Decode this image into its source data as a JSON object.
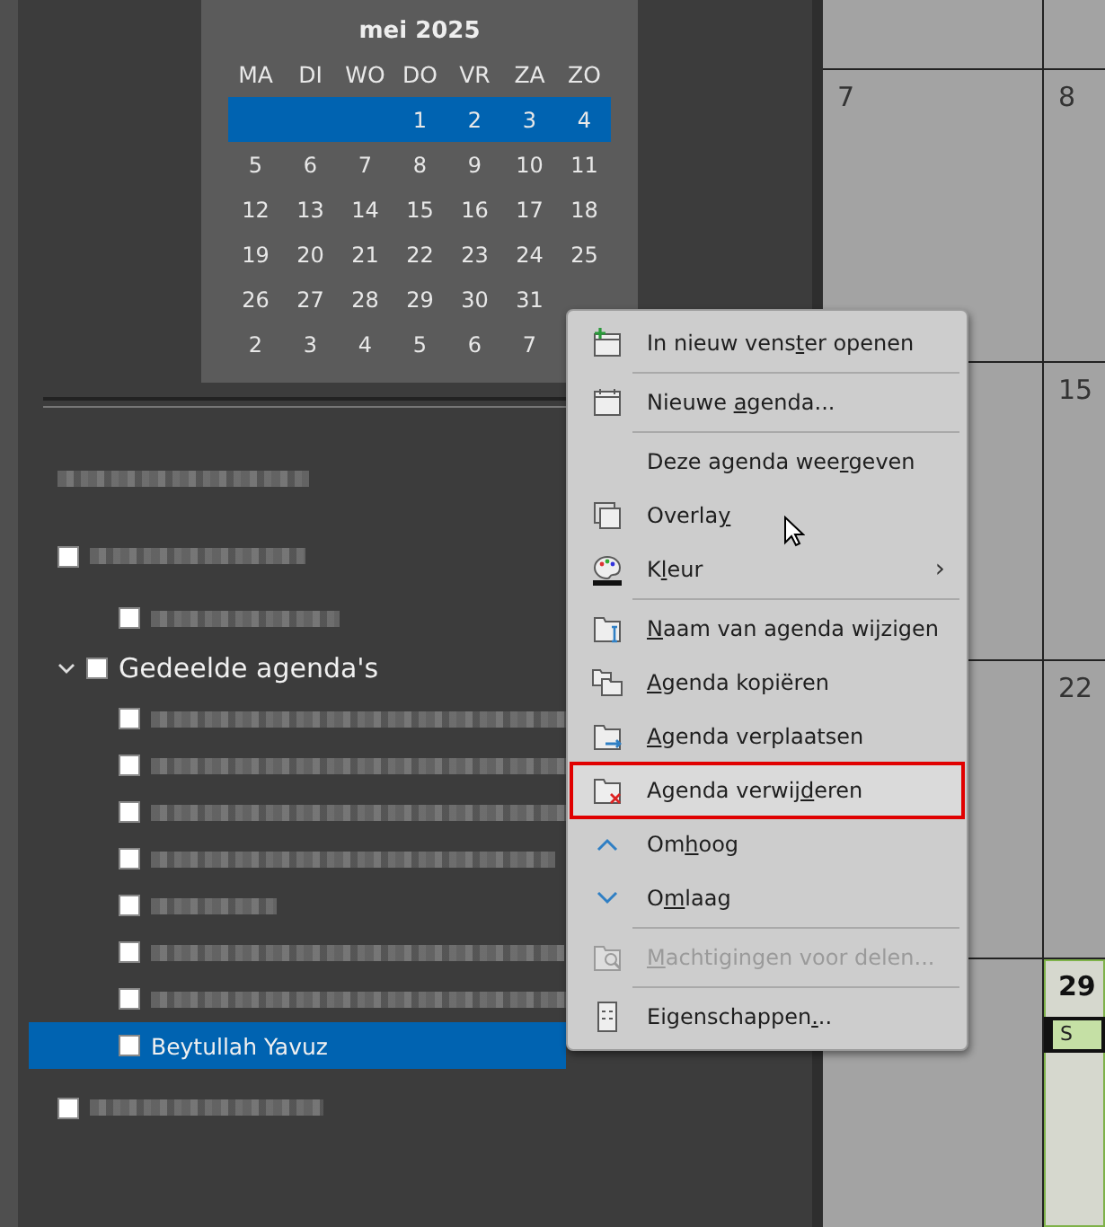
{
  "mini_calendar": {
    "title": "mei 2025",
    "weekdays": [
      "MA",
      "DI",
      "WO",
      "DO",
      "VR",
      "ZA",
      "ZO"
    ],
    "weeks": [
      {
        "selected": true,
        "days": [
          "1",
          "2",
          "3",
          "4"
        ]
      },
      {
        "selected": false,
        "days": [
          "5",
          "6",
          "7",
          "8",
          "9",
          "10",
          "11"
        ]
      },
      {
        "selected": false,
        "days": [
          "12",
          "13",
          "14",
          "15",
          "16",
          "17",
          "18"
        ]
      },
      {
        "selected": false,
        "days": [
          "19",
          "20",
          "21",
          "22",
          "23",
          "24",
          "25"
        ]
      },
      {
        "selected": false,
        "days": [
          "26",
          "27",
          "28",
          "29",
          "30",
          "31"
        ]
      },
      {
        "selected": false,
        "days": [
          "2",
          "3",
          "4",
          "5",
          "6",
          "7"
        ]
      }
    ]
  },
  "folders": [
    {
      "kind": "heading"
    },
    {
      "kind": "group",
      "checked": false,
      "children": [
        {
          "checked": false,
          "selected": false
        }
      ]
    },
    {
      "kind": "group",
      "label": "Gedeelde agenda's",
      "checked": false,
      "expanded": true,
      "children": [
        {
          "checked": false,
          "selected": false
        },
        {
          "checked": false,
          "selected": false
        },
        {
          "checked": false,
          "selected": false
        },
        {
          "checked": false,
          "selected": false
        },
        {
          "checked": false,
          "selected": false
        },
        {
          "checked": false,
          "selected": false
        },
        {
          "checked": false,
          "selected": false
        },
        {
          "label": "Beytullah Yavuz",
          "checked": false,
          "selected": true
        }
      ]
    },
    {
      "kind": "group",
      "checked": false
    }
  ],
  "month_grid": [
    [
      {
        "today": false
      },
      {
        "today": false
      }
    ],
    [
      {
        "day": "7",
        "today": false
      },
      {
        "day": "8",
        "today": false
      }
    ],
    [
      {
        "today": false
      },
      {
        "day": "15",
        "today": false
      }
    ],
    [
      {
        "today": false
      },
      {
        "day": "22",
        "today": false
      }
    ],
    [
      {
        "today": false
      },
      {
        "day": "29",
        "today": true,
        "event": "S"
      }
    ]
  ],
  "context_menu": [
    {
      "kind": "new-window",
      "label": {
        "before": "In nieuw vens",
        "key": "t",
        "after": "er openen"
      },
      "disabled": false,
      "selected": false
    },
    {
      "kind": "separator"
    },
    {
      "kind": "calendar",
      "label": {
        "before": "Nieuwe ",
        "key": "a",
        "after": "genda..."
      },
      "disabled": false,
      "selected": false
    },
    {
      "kind": "separator"
    },
    {
      "kind": "plain",
      "label": {
        "before": "Deze agenda wee",
        "key": "r",
        "after": "geven"
      },
      "disabled": false,
      "selected": false
    },
    {
      "kind": "overlay",
      "label": {
        "before": "Overla",
        "key": "y"
      },
      "disabled": false,
      "selected": false
    },
    {
      "kind": "color",
      "label": {
        "before": "K",
        "key": "l",
        "after": "eur"
      },
      "disabled": false,
      "selected": false,
      "submenu_arrow": "›"
    },
    {
      "kind": "separator"
    },
    {
      "kind": "rename",
      "label": {
        "key": "N",
        "after": "aam van agenda wijzigen"
      },
      "disabled": false,
      "selected": false
    },
    {
      "kind": "copy",
      "label": {
        "key": "A",
        "after": "genda kopiëren"
      },
      "disabled": false,
      "selected": false
    },
    {
      "kind": "move",
      "label": {
        "key": "A",
        "after": "genda verplaatsen"
      },
      "disabled": false,
      "selected": false
    },
    {
      "kind": "delete",
      "label": {
        "before": "Agenda verwij",
        "key": "d",
        "after": "eren"
      },
      "disabled": false,
      "selected": true
    },
    {
      "kind": "up",
      "label": {
        "before": "Om",
        "key": "h",
        "after": "oog"
      },
      "disabled": false,
      "selected": false
    },
    {
      "kind": "down",
      "label": {
        "before": "O",
        "key": "m",
        "after": "laag"
      },
      "disabled": false,
      "selected": false
    },
    {
      "kind": "separator"
    },
    {
      "kind": "permissions",
      "label": {
        "key": "M",
        "after": "achtigingen voor delen..."
      },
      "disabled": true,
      "selected": false
    },
    {
      "kind": "separator"
    },
    {
      "kind": "properties",
      "label": {
        "before": "Eigenschappen",
        "key": ".",
        "after": ".."
      },
      "disabled": false,
      "selected": false
    }
  ]
}
